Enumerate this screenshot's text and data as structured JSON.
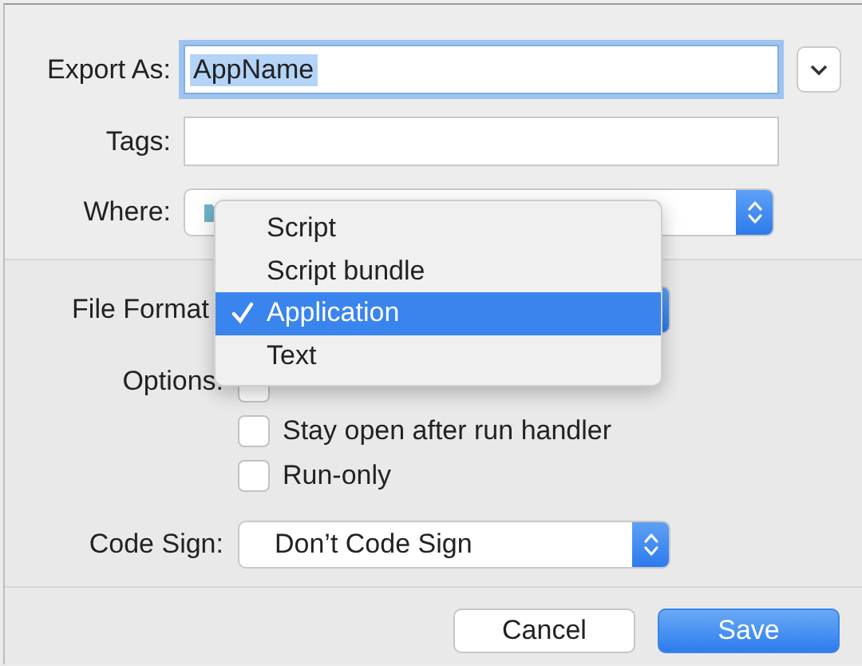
{
  "export_as": {
    "label": "Export As:",
    "value": "AppName",
    "text_selected": true
  },
  "tags": {
    "label": "Tags:"
  },
  "where": {
    "label": "Where:"
  },
  "file_format": {
    "label": "File Format"
  },
  "options": {
    "label": "Options:",
    "checkboxes": [
      {
        "checked": false
      },
      {
        "label": "Stay open after run handler",
        "checked": false
      },
      {
        "label": "Run-only",
        "checked": false
      }
    ]
  },
  "code_sign": {
    "label": "Code Sign:",
    "value": "Don’t Code Sign"
  },
  "menu": {
    "items": [
      {
        "label": "Script",
        "selected": false
      },
      {
        "label": "Script bundle",
        "selected": false
      },
      {
        "label": "Application",
        "selected": true
      },
      {
        "label": "Text",
        "selected": false
      }
    ]
  },
  "buttons": [
    {
      "label": "Cancel",
      "kind": "normal"
    },
    {
      "label": "Save",
      "kind": "default"
    }
  ]
}
